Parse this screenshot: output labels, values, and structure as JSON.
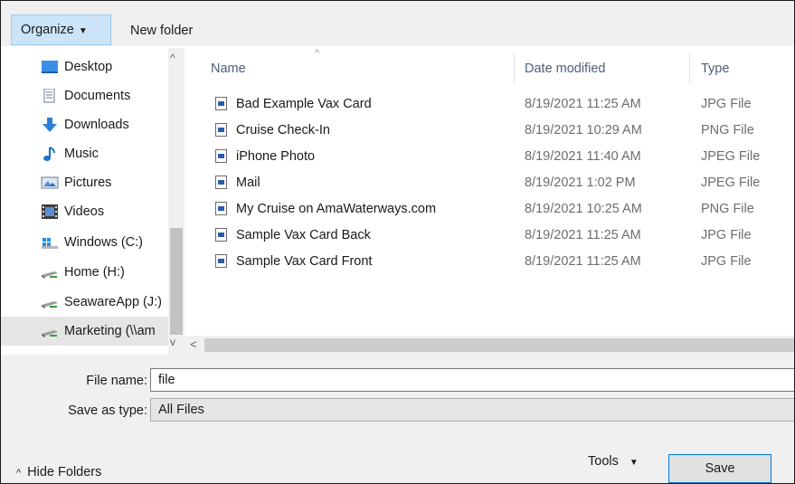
{
  "toolbar": {
    "organize_label": "Organize",
    "new_folder_label": "New folder"
  },
  "nav": {
    "items": [
      {
        "label": "Desktop",
        "icon": "desktop-icon"
      },
      {
        "label": "Documents",
        "icon": "documents-icon"
      },
      {
        "label": "Downloads",
        "icon": "downloads-icon"
      },
      {
        "label": "Music",
        "icon": "music-icon"
      },
      {
        "label": "Pictures",
        "icon": "pictures-icon"
      },
      {
        "label": "Videos",
        "icon": "videos-icon"
      },
      {
        "label": "Windows (C:)",
        "icon": "windows-drive-icon"
      },
      {
        "label": "Home (H:)",
        "icon": "network-drive-icon"
      },
      {
        "label": "SeawareApp (J:)",
        "icon": "network-drive-icon"
      },
      {
        "label": "Marketing (\\\\am",
        "icon": "network-drive-icon",
        "selected": true
      }
    ]
  },
  "file_list": {
    "columns": {
      "name": "Name",
      "date": "Date modified",
      "type": "Type"
    },
    "rows": [
      {
        "name": "Bad Example Vax Card",
        "date": "8/19/2021 11:25 AM",
        "type": "JPG File"
      },
      {
        "name": "Cruise Check-In",
        "date": "8/19/2021 10:29 AM",
        "type": "PNG File"
      },
      {
        "name": "iPhone Photo",
        "date": "8/19/2021 11:40 AM",
        "type": "JPEG File"
      },
      {
        "name": "Mail",
        "date": "8/19/2021 1:02 PM",
        "type": "JPEG File"
      },
      {
        "name": "My Cruise on AmaWaterways.com",
        "date": "8/19/2021 10:25 AM",
        "type": "PNG File"
      },
      {
        "name": "Sample Vax Card Back",
        "date": "8/19/2021 11:25 AM",
        "type": "JPG File"
      },
      {
        "name": "Sample Vax Card Front",
        "date": "8/19/2021 11:25 AM",
        "type": "JPG File"
      }
    ]
  },
  "form": {
    "file_name_label": "File name:",
    "file_name_value": "file",
    "save_as_type_label": "Save as type:",
    "save_as_type_value": "All Files",
    "hide_folders_label": "Hide Folders",
    "tools_label": "Tools",
    "save_label": "Save"
  },
  "colors": {
    "accent": "#0078d7",
    "toolbar_bg": "#f0f0f0",
    "organize_highlight": "#cce4f7",
    "header_text": "#4c607a"
  }
}
